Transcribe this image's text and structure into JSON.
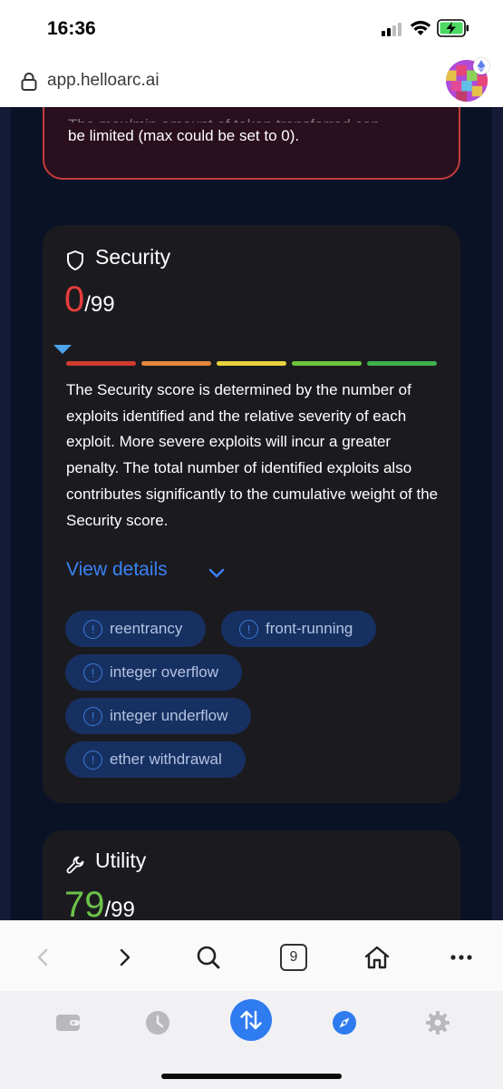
{
  "status_bar": {
    "time": "16:36"
  },
  "browser": {
    "url": "app.helloarc.ai"
  },
  "warning_card": {
    "text_line1": "The max/min amount of token transferred can",
    "text_line2": "be limited (max could be set to 0)."
  },
  "security": {
    "title": "Security",
    "score": "0",
    "max": "/99",
    "description": "The Security score is determined by the number of exploits identified and the relative severity of each exploit. More severe exploits will incur a greater penalty. The total number of identified exploits also contributes significantly to the cumulative weight of the Security score.",
    "view_details": "View details",
    "tags": [
      {
        "label": "reentrancy"
      },
      {
        "label": "front-running"
      },
      {
        "label": "integer overflow"
      },
      {
        "label": "integer underflow"
      },
      {
        "label": "ether withdrawal"
      }
    ],
    "severity_colors": [
      "#d23a2f",
      "#e3893a",
      "#e9d23c",
      "#6bc63e",
      "#3fb04e"
    ]
  },
  "utility": {
    "title": "Utility",
    "score": "79",
    "max": "/99"
  },
  "safari_toolbar": {
    "tab_count": "9"
  },
  "colors": {
    "page_bg": "#0a1226",
    "card_bg": "#1b1b1f",
    "accent_blue": "#3a82f6",
    "danger": "#e53c3c",
    "success": "#6cc24a"
  }
}
